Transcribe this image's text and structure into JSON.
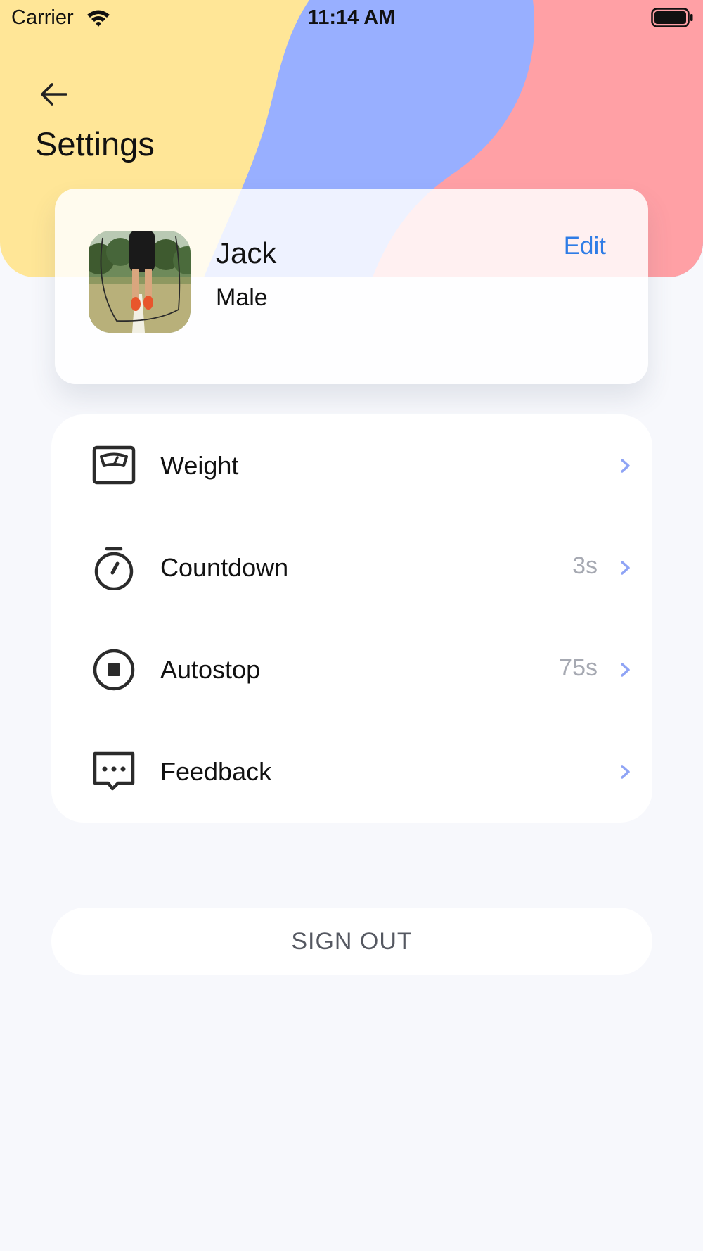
{
  "status_bar": {
    "carrier": "Carrier",
    "time": "11:14 AM"
  },
  "header": {
    "title": "Settings"
  },
  "profile": {
    "name": "Jack",
    "gender": "Male",
    "edit_label": "Edit"
  },
  "settings": [
    {
      "label": "Weight",
      "value": "",
      "icon": "scale-icon"
    },
    {
      "label": "Countdown",
      "value": "3s",
      "icon": "stopwatch-icon"
    },
    {
      "label": "Autostop",
      "value": "75s",
      "icon": "stop-circle-icon"
    },
    {
      "label": "Feedback",
      "value": "",
      "icon": "message-bubble-icon"
    }
  ],
  "sign_out_label": "SIGN OUT",
  "colors": {
    "wave_yellow": "#FFE697",
    "wave_blue": "#98AFFF",
    "wave_pink": "#FFA0A5",
    "accent_blue": "#2E7CE6",
    "chevron": "#8FA4F5",
    "background": "#F7F8FC"
  }
}
